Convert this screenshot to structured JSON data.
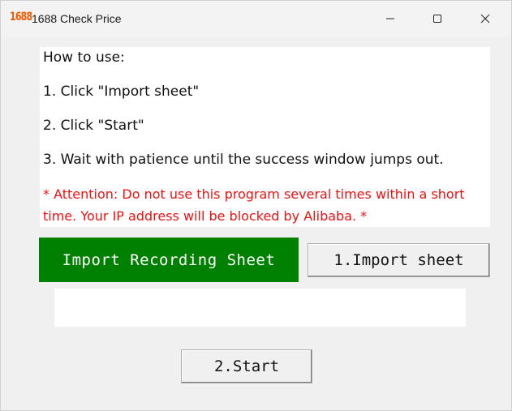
{
  "window": {
    "logo_text": "1688",
    "title": "1688 Check Price",
    "min_glyph": "—",
    "max_glyph": "☐",
    "close_glyph": "✕"
  },
  "instructions": {
    "heading": "How to use:",
    "step1": "1. Click \"Import sheet\"",
    "step2": "2. Click \"Start\"",
    "step3": "3. Wait with patience until the success window jumps out.",
    "attention": "* Attention: Do not use this program several times within a short time. Your IP address will be blocked by Alibaba. *"
  },
  "import_section": {
    "label": "Import Recording Sheet",
    "button_label": "1.Import sheet",
    "path_value": "",
    "path_placeholder": ""
  },
  "start_button_label": "2.Start",
  "colors": {
    "label_bg": "#008000",
    "attention_text": "#ee1111",
    "logo": "#f05a00"
  },
  "icons": {
    "minimize": "minimize-icon",
    "maximize": "maximize-icon",
    "close": "close-icon"
  }
}
